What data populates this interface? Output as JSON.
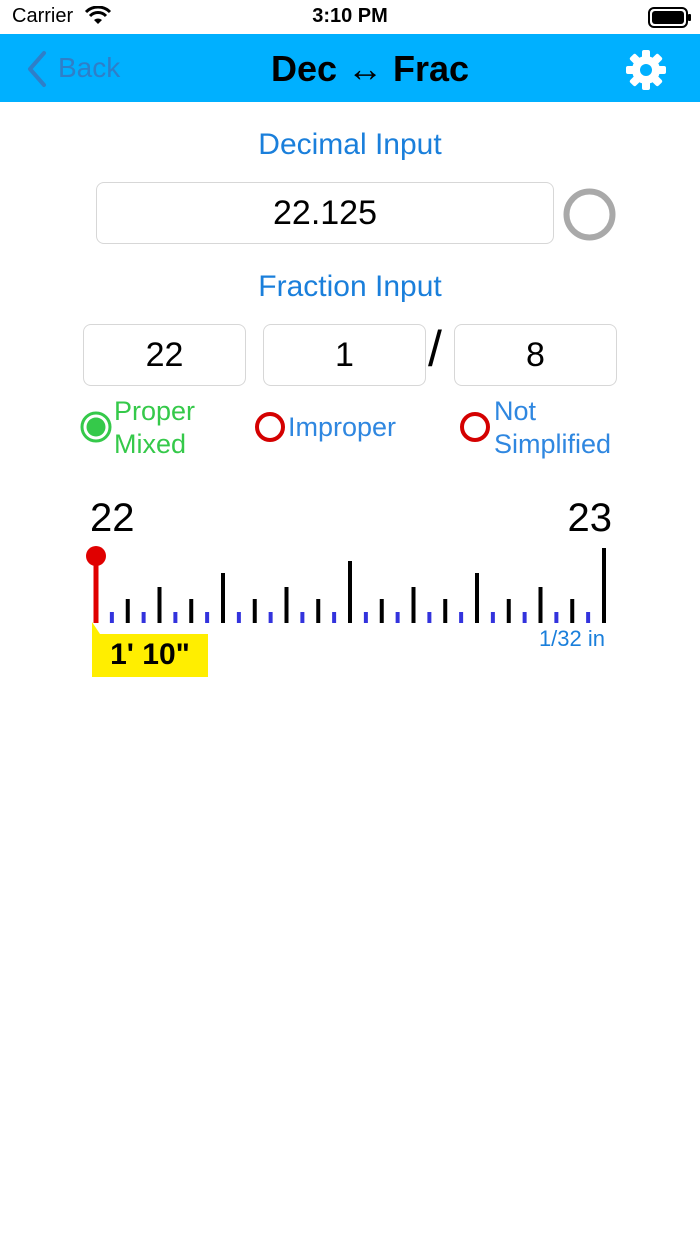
{
  "status_bar": {
    "carrier": "Carrier",
    "time": "3:10 PM"
  },
  "nav": {
    "back_label": "Back",
    "title": "Dec ↔ Frac",
    "settings_icon": "gear-icon",
    "bar_color": "#00b0ff"
  },
  "decimal": {
    "heading": "Decimal Input",
    "value": "22.125"
  },
  "fraction": {
    "heading": "Fraction Input",
    "whole": "22",
    "numerator": "1",
    "slash": "/",
    "denominator": "8"
  },
  "format_options": [
    {
      "label_line1": "Proper",
      "label_line2": "Mixed",
      "selected": true
    },
    {
      "label_line1": "Improper",
      "label_line2": "",
      "selected": false
    },
    {
      "label_line1": "Not",
      "label_line2": "Simplified",
      "selected": false
    }
  ],
  "ruler": {
    "start_label": "22",
    "end_label": "23",
    "resolution_label": "1/32 in",
    "feet_inches_label": "1' 10\"",
    "divisions": 32,
    "marker_value": 22.0,
    "colors": {
      "major_tick": "#000000",
      "minor_tick": "#3333dd",
      "marker": "#e00000",
      "badge": "#ffee00",
      "accent_text": "#1a7fdb"
    }
  }
}
